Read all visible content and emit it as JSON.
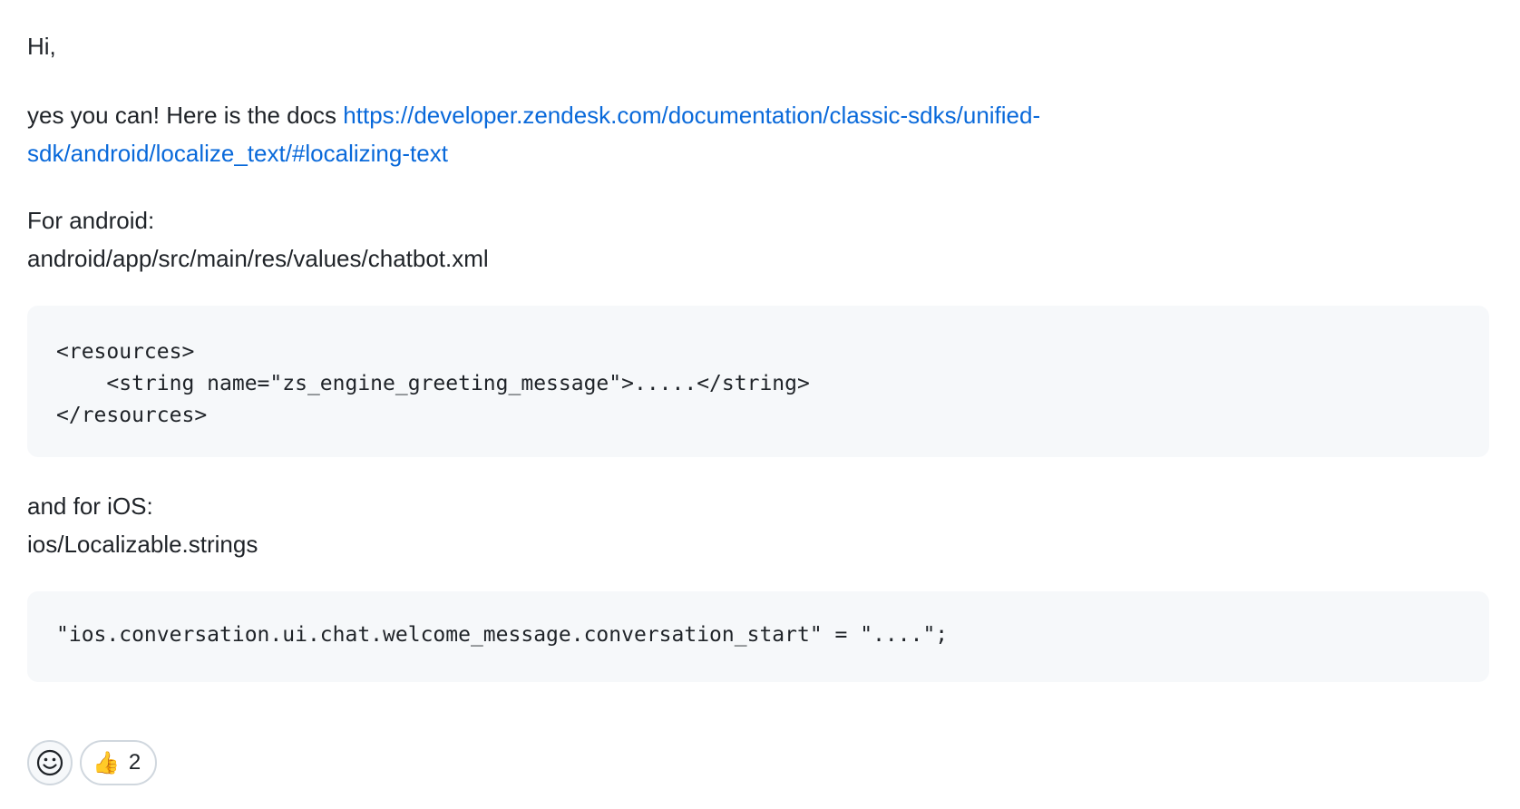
{
  "comment": {
    "greeting": "Hi,",
    "intro_text": "yes you can! Here is the docs ",
    "docs_link": "https://developer.zendesk.com/documentation/classic-sdks/unified-sdk/android/localize_text/#localizing-text",
    "android_heading": "For android:",
    "android_path": "android/app/src/main/res/values/chatbot.xml",
    "android_code": "<resources>\n    <string name=\"zs_engine_greeting_message\">.....</string>\n</resources>",
    "ios_heading": "and for iOS:",
    "ios_path": "ios/Localizable.strings",
    "ios_code": "\"ios.conversation.ui.chat.welcome_message.conversation_start\" = \"....\";"
  },
  "reactions": {
    "picker_icon": "smiley-icon",
    "items": [
      {
        "icon": "thumbs-up-icon",
        "glyph": "👍",
        "count": "2"
      }
    ]
  },
  "colors": {
    "link": "#0969da",
    "code_background": "#f6f8fa",
    "text": "#1f2328"
  }
}
